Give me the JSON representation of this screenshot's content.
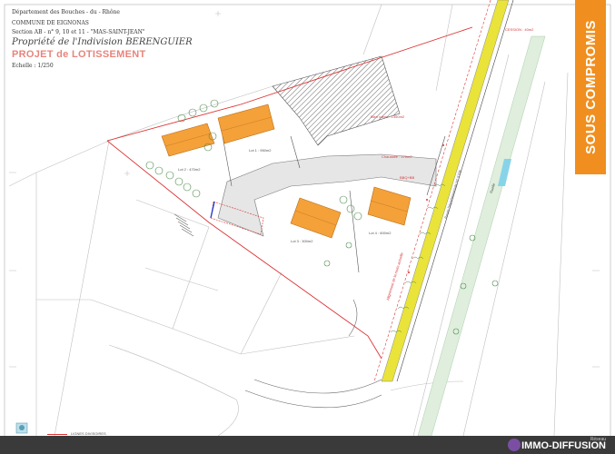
{
  "header": {
    "department": "Département des Bouches - du - Rhône",
    "commune": "COMMUNE DE EIGNONAS",
    "section": "Section AB - n° 9, 10 et 11 - \"MAS-SAINT-JEAN\"",
    "propriete": "Propriété de l'Indivision BERENGUIER",
    "projet": "PROJET de LOTISSEMENT",
    "echelle": "Echelle : 1/250"
  },
  "banner": {
    "text": "SOUS COMPROMIS",
    "color": "#f08f1f"
  },
  "lots": [
    {
      "label": "Lot 1 : 950m2"
    },
    {
      "label": "Lot 2 : 470m2"
    },
    {
      "label": "Lot 3 : 300m2"
    },
    {
      "label": "Lot 4 : 600m2"
    }
  ],
  "plan_labels": {
    "bien_voisin": "Bien voisin : 1350m2",
    "chaussee": "Chaussée : 470m2",
    "bbq": "BBQ+BB",
    "cession": "CESSION : 40m2",
    "route": "Route Départementale N° 5706",
    "ruelle": "Ruelle",
    "alignement": "Alignement de la route actuelle"
  },
  "legend": {
    "label": "LIGNES DIVISOIRES"
  },
  "footer": {
    "brand": "IMMO-DIFFUSION",
    "reseau": "Réseau"
  },
  "colors": {
    "house": "#f4a13a",
    "road": "#e6e6e6",
    "division_line": "#d33",
    "highway_band": "#e9e33a",
    "banner": "#f08f1f",
    "footer_bg": "#3a3a3a"
  },
  "icons": [
    "house-icon",
    "stamp-icon",
    "logo-icon"
  ]
}
